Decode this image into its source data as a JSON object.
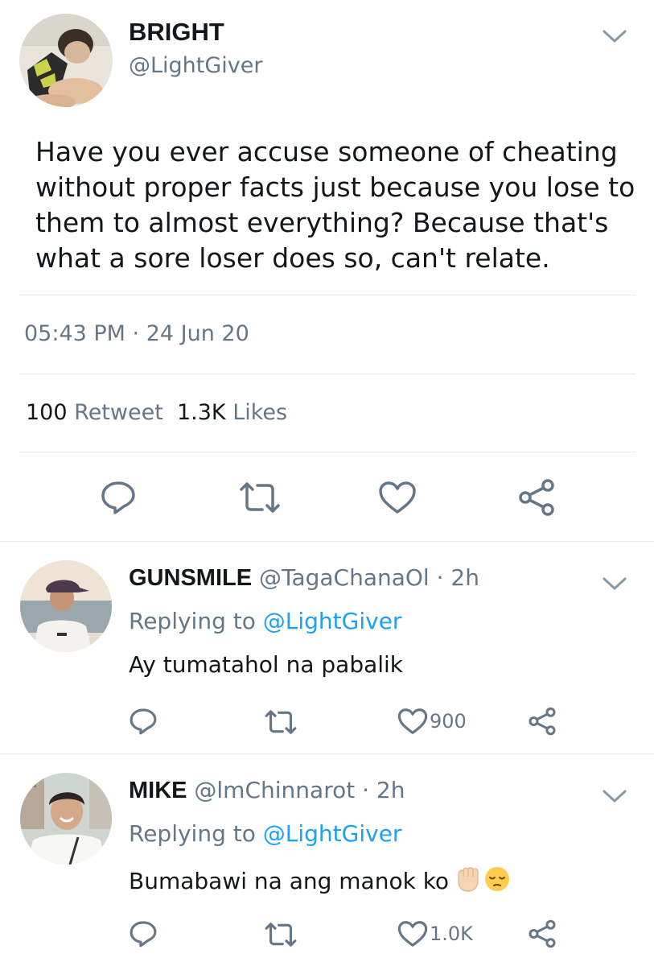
{
  "main_tweet": {
    "display_name": "BRIGHT",
    "handle": "@LightGiver",
    "text": "Have you ever accuse someone of cheating without proper facts just because you lose to them to almost everything? Because that's what a sore loser does so, can't relate.",
    "timestamp": "05:43 PM · 24 Jun 20",
    "retweet_count": "100",
    "retweet_label": "Retweet",
    "likes_count": "1.3K",
    "likes_label": "Likes",
    "actions": [
      "reply-icon",
      "retweet-icon",
      "like-icon",
      "share-icon"
    ]
  },
  "replies": [
    {
      "display_name": "GUNSMILE",
      "handle_time": "@TagaChanaOl · 2h",
      "replying_prefix": "Replying to",
      "replying_to": "@LightGiver",
      "text": "Ay tumatahol na pabalik",
      "like_count": "900",
      "emoji": []
    },
    {
      "display_name": "MIKE",
      "handle_time": "@lmChinnarot · 2h",
      "replying_prefix": "Replying to",
      "replying_to": "@LightGiver",
      "text": "Bumabawi na ang manok ko",
      "like_count": "1.0K",
      "emoji": [
        "raised-fist-emoji",
        "pensive-face-emoji"
      ]
    }
  ],
  "colors": {
    "text_primary": "#14171a",
    "text_secondary": "#657786",
    "link": "#1da1f2",
    "divider": "#e1e8ed"
  }
}
